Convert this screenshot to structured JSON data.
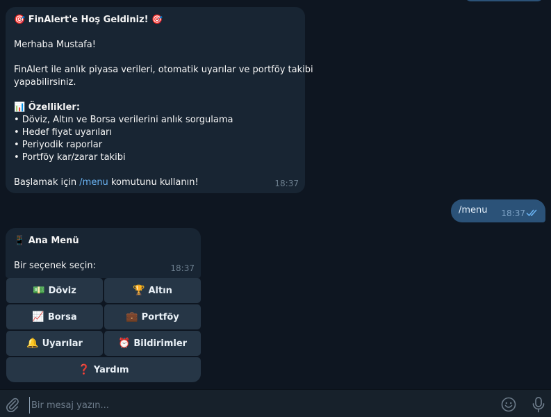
{
  "welcome_message": {
    "title": "🎯 FinAlert'e Hoş Geldiniz! 🎯",
    "greeting": "Merhaba Mustafa!",
    "intro_line1": "FinAlert ile anlık piyasa verileri, otomatik uyarılar ve portföy takibi",
    "intro_line2": "yapabilirsiniz.",
    "features_title": "📊 Özellikler:",
    "features": [
      "• Döviz, Altın ve Borsa verilerini anlık sorgulama",
      "• Hedef fiyat uyarıları",
      "• Periyodik raporlar",
      "• Portföy kar/zarar takibi"
    ],
    "footer_prefix": "Başlamak için ",
    "footer_command": "/menu",
    "footer_suffix": " komutunu kullanın!",
    "time": "18:37"
  },
  "outgoing_message": {
    "text": "/menu",
    "time": "18:37"
  },
  "menu_message": {
    "title": "📱 Ana Menü",
    "prompt": "Bir seçenek seçin:",
    "time": "18:37"
  },
  "keyboard": {
    "doviz": {
      "emoji": "💵",
      "label": "Döviz"
    },
    "altin": {
      "emoji": "🏆",
      "label": "Altın"
    },
    "borsa": {
      "emoji": "📈",
      "label": "Borsa"
    },
    "portfoy": {
      "emoji": "💼",
      "label": "Portföy"
    },
    "uyarilar": {
      "emoji": "🔔",
      "label": "Uyarılar"
    },
    "bildirimler": {
      "emoji": "⏰",
      "label": "Bildirimler"
    },
    "yardim": {
      "emoji": "❓",
      "label": "Yardım"
    }
  },
  "composer": {
    "placeholder": "Bir mesaj yazın...",
    "icons": [
      "paperclip-icon",
      "emoji-icon",
      "microphone-icon"
    ]
  },
  "colors": {
    "background": "#0e1621",
    "incoming_bubble": "#182533",
    "outgoing_bubble": "#2b5278",
    "keyboard_button": "#263646",
    "link": "#6ab3f3",
    "composer": "#17212b"
  }
}
